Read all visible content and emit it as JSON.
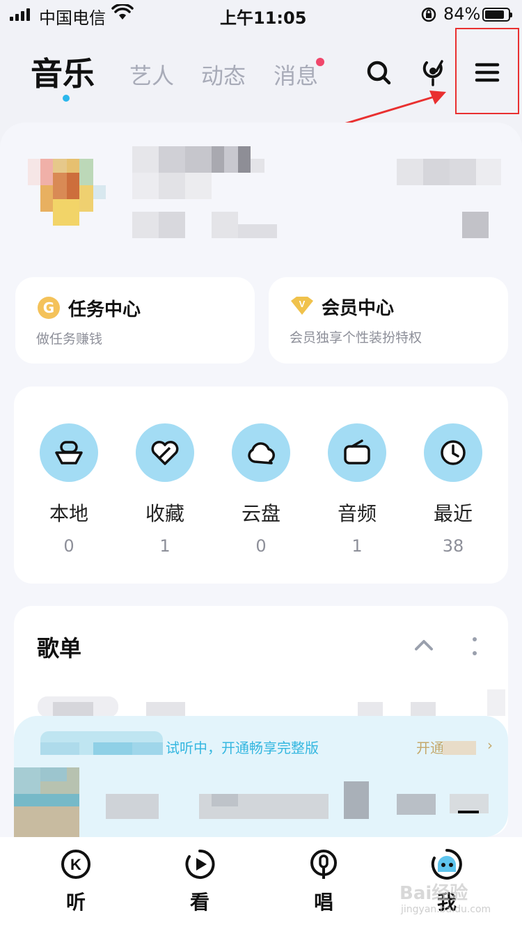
{
  "status_bar": {
    "carrier": "中国电信",
    "time": "上午11:05",
    "battery_percent": "84%",
    "battery_level": 0.84
  },
  "top_tabs": {
    "active": "音乐",
    "items": [
      "艺人",
      "动态",
      "消息"
    ]
  },
  "icons": {
    "search": "search-icon",
    "recognize": "music-recognition-icon",
    "menu": "menu-icon"
  },
  "cards": {
    "task": {
      "title": "任务中心",
      "subtitle": "做任务赚钱",
      "icon": "G"
    },
    "vip": {
      "title": "会员中心",
      "subtitle": "会员独享个性装扮特权",
      "icon": "V"
    }
  },
  "quick_access": [
    {
      "label": "本地",
      "count": "0",
      "icon": "local-icon"
    },
    {
      "label": "收藏",
      "count": "1",
      "icon": "favorite-icon"
    },
    {
      "label": "云盘",
      "count": "0",
      "icon": "cloud-icon"
    },
    {
      "label": "音频",
      "count": "1",
      "icon": "radio-icon"
    },
    {
      "label": "最近",
      "count": "38",
      "icon": "clock-icon"
    }
  ],
  "playlist": {
    "title": "歌单"
  },
  "mini_player": {
    "trial_text": "试听中，开通畅享完整版",
    "trial_button": "开通"
  },
  "bottom_nav": [
    {
      "label": "听",
      "icon": "listen-icon"
    },
    {
      "label": "看",
      "icon": "watch-icon"
    },
    {
      "label": "唱",
      "icon": "sing-icon"
    },
    {
      "label": "我",
      "icon": "me-icon"
    }
  ],
  "watermark": {
    "brand": "Bai经验",
    "url": "jingyan.baidu.com"
  },
  "colors": {
    "accent": "#2bb7ec",
    "icon_bg": "#a3dcf4",
    "badge": "#f0476b",
    "annotation": "#e93030"
  }
}
